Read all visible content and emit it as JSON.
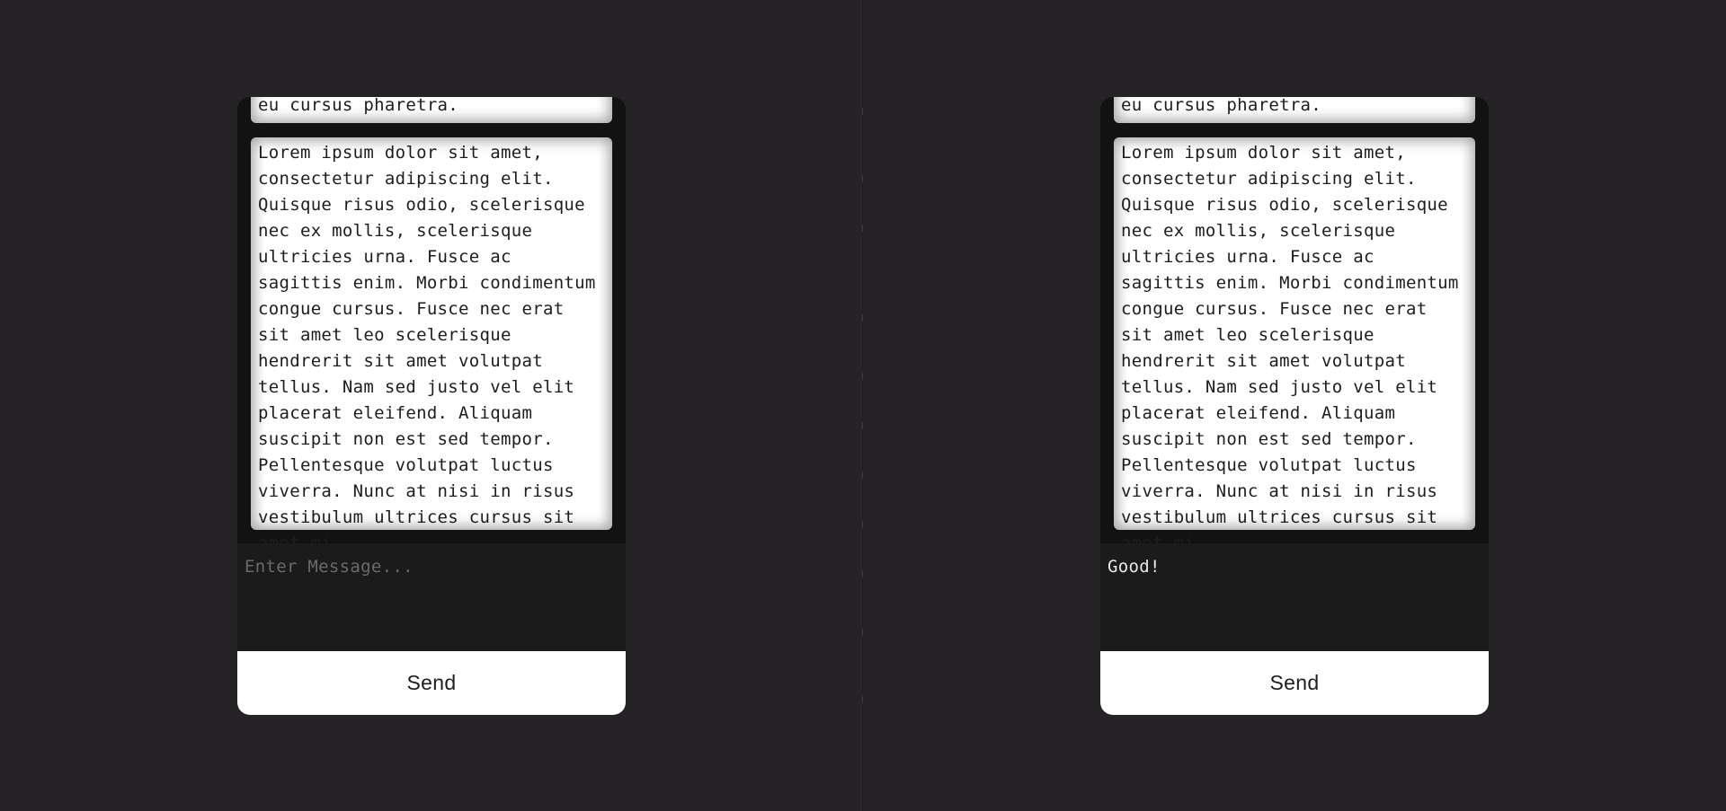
{
  "panes": {
    "left": {
      "messages": {
        "partial_text": "eu cursus pharetra.",
        "full_text": "Lorem ipsum dolor sit amet, consectetur adipiscing elit. Quisque risus odio, scelerisque nec ex mollis, scelerisque ultricies urna. Fusce ac sagittis enim. Morbi condimentum congue cursus. Fusce nec erat sit amet leo scelerisque hendrerit sit amet volutpat tellus. Nam sed justo vel elit placerat eleifend. Aliquam suscipit non est sed tempor. Pellentesque volutpat luctus viverra. Nunc at nisi in risus vestibulum ultrices cursus sit amet mi."
      },
      "composer": {
        "value": "",
        "placeholder": "Enter Message..."
      },
      "send_label": "Send"
    },
    "right": {
      "messages": {
        "partial_text": "eu cursus pharetra.",
        "full_text": "Lorem ipsum dolor sit amet, consectetur adipiscing elit. Quisque risus odio, scelerisque nec ex mollis, scelerisque ultricies urna. Fusce ac sagittis enim. Morbi condimentum congue cursus. Fusce nec erat sit amet leo scelerisque hendrerit sit amet volutpat tellus. Nam sed justo vel elit placerat eleifend. Aliquam suscipit non est sed tempor. Pellentesque volutpat luctus viverra. Nunc at nisi in risus vestibulum ultrices cursus sit amet mi."
      },
      "composer": {
        "value": "Good!",
        "placeholder": "Enter Message..."
      },
      "send_label": "Send"
    }
  },
  "colors": {
    "page_background": "#252325",
    "messages_background": "#121212",
    "bubble_background": "#ffffff",
    "composer_background": "#1b1b1b",
    "send_background": "#ffffff",
    "text_dark": "#1d1d1d",
    "text_light": "#e8e8e8",
    "placeholder": "#6a6a6a"
  }
}
